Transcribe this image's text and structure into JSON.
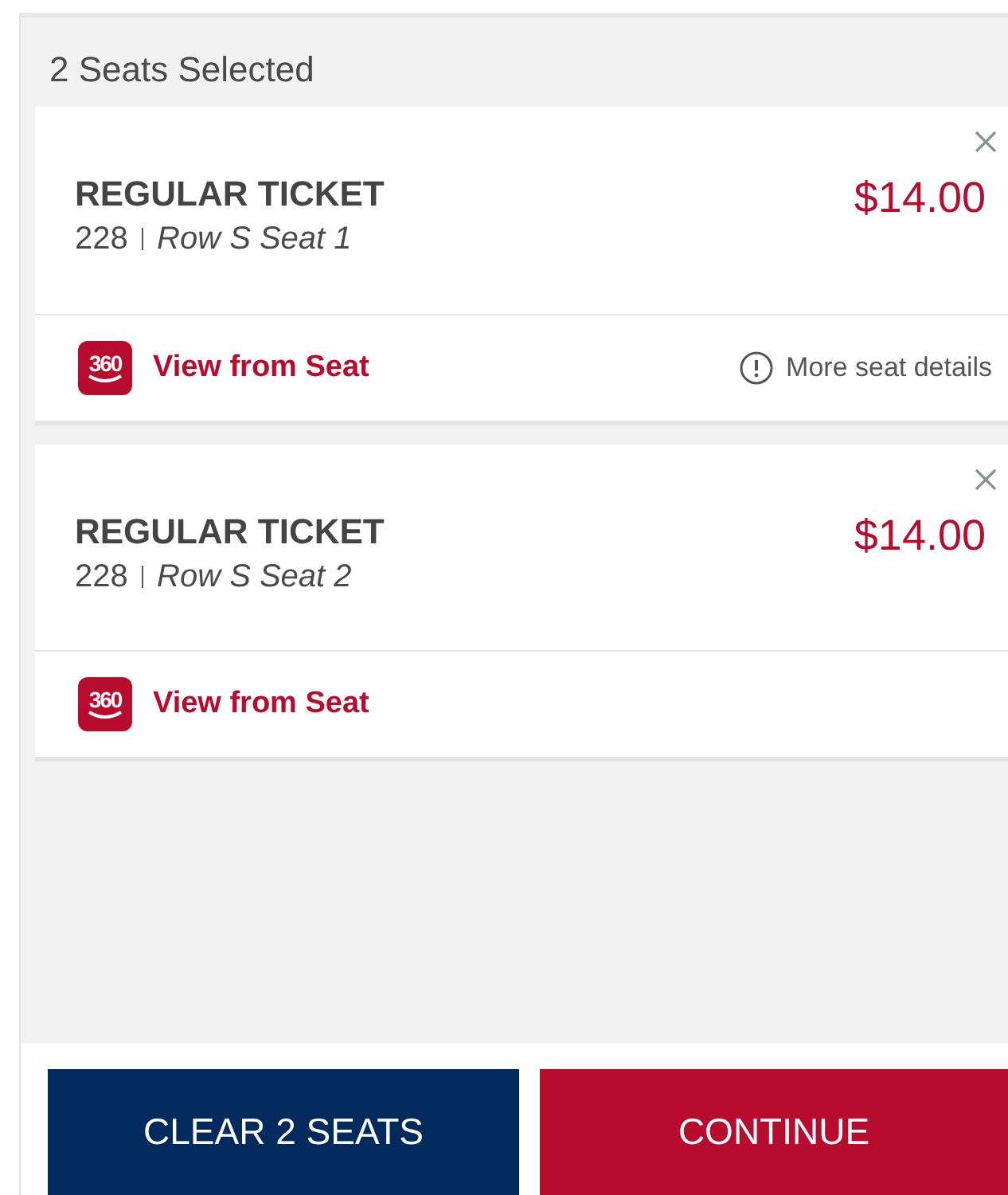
{
  "header": {
    "title": "2 Seats Selected"
  },
  "tickets": [
    {
      "type": "REGULAR TICKET",
      "section": "228",
      "seat": "Row S Seat 1",
      "price": "$14.00",
      "view_badge": "360",
      "view_link": "View from Seat",
      "details_link": "More seat details"
    },
    {
      "type": "REGULAR TICKET",
      "section": "228",
      "seat": "Row S Seat 2",
      "price": "$14.00",
      "view_badge": "360",
      "view_link": "View from Seat"
    }
  ],
  "buttons": [
    {
      "kind": "secondary",
      "label": "CLEAR 2 SEATS"
    },
    {
      "kind": "primary",
      "label": "CONTINUE"
    }
  ]
}
